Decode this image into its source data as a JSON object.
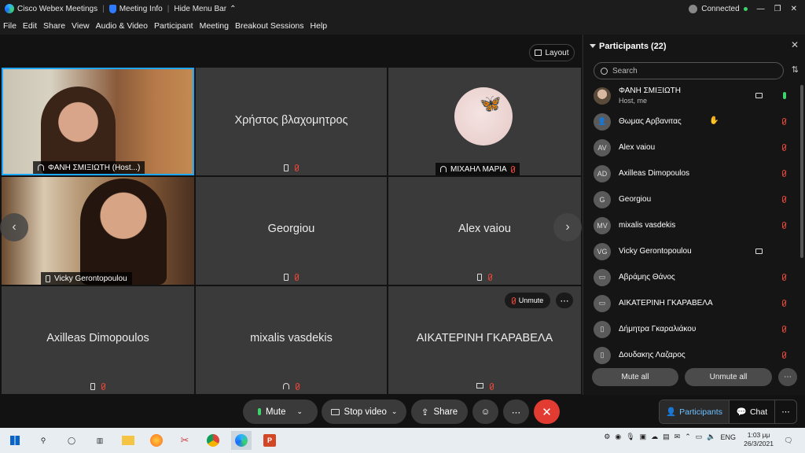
{
  "titlebar": {
    "app_title": "Cisco Webex Meetings",
    "meeting_info": "Meeting Info",
    "hide_menu": "Hide Menu Bar",
    "status": "Connected"
  },
  "menu": [
    "File",
    "Edit",
    "Share",
    "View",
    "Audio & Video",
    "Participant",
    "Meeting",
    "Breakout Sessions",
    "Help"
  ],
  "layout_label": "Layout",
  "tiles": {
    "host": "ΦΑΝΗ ΣΜΙΞΙΩΤΗ (Host...)",
    "t2": "Χρήστος βλαχομητρος",
    "t3": "ΜΙΧΑΗΛ ΜΑΡΙΑ",
    "t4": "Vicky Gerontopoulou",
    "t5": "Georgiou",
    "t6": "Alex vaiou",
    "t7": "Axilleas Dimopoulos",
    "t8": "mixalis vasdekis",
    "t9": "ΑΙΚΑΤΕΡΙΝΗ ΓΚΑΡΑΒΕΛΑ"
  },
  "unmute_pill": "Unmute",
  "panel": {
    "title": "Participants (22)",
    "search_placeholder": "Search",
    "participants": [
      {
        "name": "ΦΑΝΗ ΣΜΙΞΙΩΤΗ",
        "sub": "Host, me",
        "initials": ""
      },
      {
        "name": "Θωμας Αρβανιτας",
        "initials": ""
      },
      {
        "name": "Alex vaiou",
        "initials": "AV"
      },
      {
        "name": "Axilleas Dimopoulos",
        "initials": "AD"
      },
      {
        "name": "Georgiou",
        "initials": "G"
      },
      {
        "name": "mixalis vasdekis",
        "initials": "MV"
      },
      {
        "name": "Vicky Gerontopoulou",
        "initials": "VG"
      },
      {
        "name": "Αβράμης Θάνος",
        "initials": ""
      },
      {
        "name": "ΑΙΚΑΤΕΡΙΝΗ ΓΚΑΡΑΒΕΛΑ",
        "initials": ""
      },
      {
        "name": "Δήμητρα Γκαραλιάκου",
        "initials": ""
      },
      {
        "name": "Δουδακης Λαζαρος",
        "initials": ""
      }
    ],
    "mute_all": "Mute all",
    "unmute_all": "Unmute all"
  },
  "toolbar": {
    "mute": "Mute",
    "stop_video": "Stop video",
    "share": "Share",
    "participants": "Participants",
    "chat": "Chat"
  },
  "taskbar": {
    "lang": "ENG",
    "time": "1:03 μμ",
    "date": "26/3/2021"
  },
  "colors": {
    "accent": "#1ea7ff",
    "end": "#e23b31",
    "muted": "#e0463a",
    "active": "#3cd46b"
  }
}
